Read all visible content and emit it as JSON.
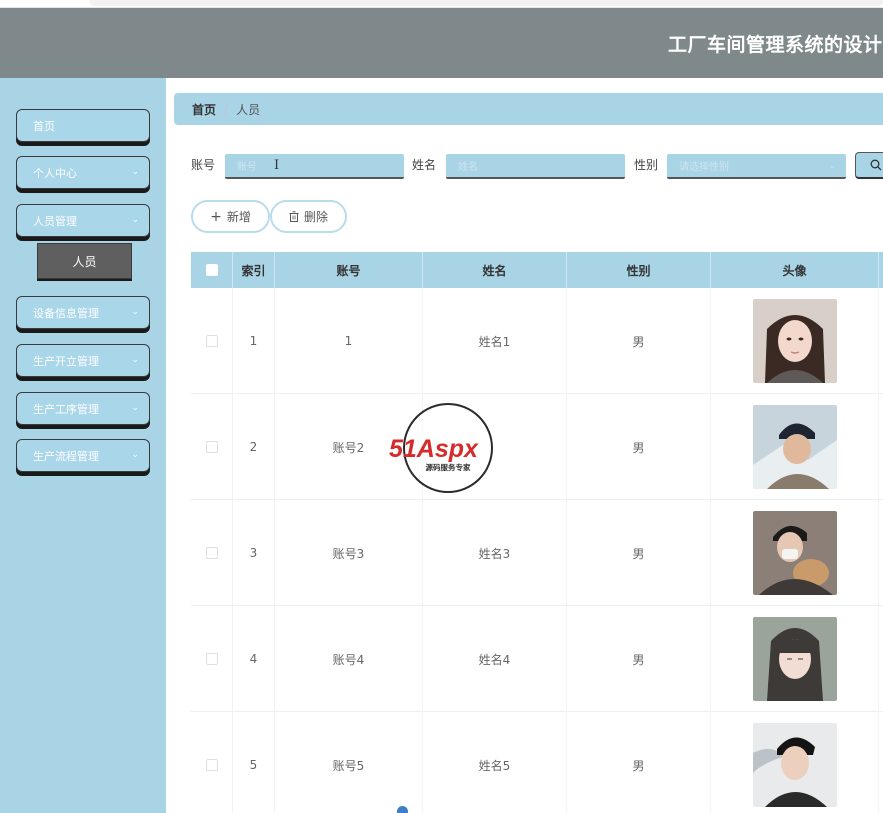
{
  "header": {
    "title": "工厂车间管理系统的设计"
  },
  "sidebar": {
    "items": [
      {
        "label": "首页",
        "has_chevron": false
      },
      {
        "label": "个人中心",
        "has_chevron": true
      },
      {
        "label": "人员管理",
        "has_chevron": true
      },
      {
        "label": "设备信息管理",
        "has_chevron": true
      },
      {
        "label": "生产开立管理",
        "has_chevron": true
      },
      {
        "label": "生产工序管理",
        "has_chevron": true
      },
      {
        "label": "生产流程管理",
        "has_chevron": true
      }
    ],
    "submenu": {
      "label": "人员"
    }
  },
  "breadcrumb": {
    "home": "首页",
    "current": "人员"
  },
  "search": {
    "account_label": "账号",
    "account_placeholder": "账号",
    "name_label": "姓名",
    "name_placeholder": "姓名",
    "gender_label": "性别",
    "gender_placeholder": "请选择性别",
    "search_icon": "search-icon"
  },
  "actions": {
    "add_label": "新增",
    "delete_label": "删除"
  },
  "table": {
    "columns": [
      "索引",
      "账号",
      "姓名",
      "性别",
      "头像"
    ],
    "rows": [
      {
        "index": "1",
        "account": "1",
        "name": "姓名1",
        "gender": "男"
      },
      {
        "index": "2",
        "account": "账号2",
        "name": "",
        "gender": "男"
      },
      {
        "index": "3",
        "account": "账号3",
        "name": "姓名3",
        "gender": "男"
      },
      {
        "index": "4",
        "account": "账号4",
        "name": "姓名4",
        "gender": "男"
      },
      {
        "index": "5",
        "account": "账号5",
        "name": "姓名5",
        "gender": "男"
      }
    ]
  },
  "watermark": {
    "brand": "51Aspx",
    "slogan": "源码服务专家"
  },
  "colors": {
    "header_bg": "#7f888b",
    "sidebar_bg": "#a9d4e6",
    "accent_blue": "#a9d4e6",
    "submenu_active": "#5f5f5f"
  }
}
